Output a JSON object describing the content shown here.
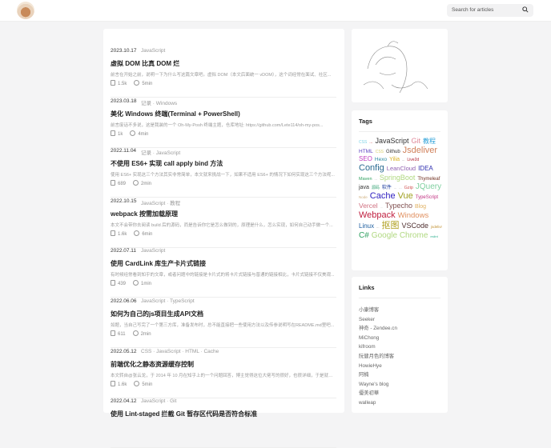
{
  "header": {
    "search_placeholder": "Search for articles"
  },
  "posts": [
    {
      "date": "2023.10.17",
      "cats": "JavaScript",
      "title": "虚拟 DOM 比真 DOM 烂",
      "excerpt": "前言在开始之前，说明一下为什么写这篇文章吧。虚拟 DOM（本文后面统一 vDOM），这个词经常在面试、社区...",
      "views": "1.5k",
      "time": "5min"
    },
    {
      "date": "2023.03.18",
      "cats": "记录 · Windows",
      "title": "美化 Windows 终端(Terminal + PowerShell)",
      "excerpt": "前言废话不多说，这是我装的一个 Oh-My-Posh 终端主题，仓库地址: https://github.com/Lete114/oh-my-pos...",
      "views": "1k",
      "time": "4min"
    },
    {
      "date": "2022.11.04",
      "cats": "记录 · JavaScript",
      "title": "不使用 ES6+ 实现 call apply bind 方法",
      "excerpt": "使用 ES6+ 实现这三个方法其实非常简单，本文就来挑战一下，如果不适用 ES6+ 的情况下如何实现这三个方法呢...",
      "views": "689",
      "time": "2min"
    },
    {
      "date": "2022.10.15",
      "cats": "JavaScript · 教程",
      "title": "webpack 按需加载原理",
      "excerpt": "本文不会带你去阅读 build 后的源码，而是告诉你它是怎么做到的，原理是什么，怎么实现，如何自己动手做一个...",
      "views": "1.6k",
      "time": "6min"
    },
    {
      "date": "2022.07.11",
      "cats": "JavaScript",
      "title": "使用 CardLink 库生产卡片式链接",
      "excerpt": "有时候经常看到知乎的文章，或者问题中的链接是卡片式的将卡片式链接与普通的链接相比，卡片式链接不仅美观...",
      "views": "439",
      "time": "1min"
    },
    {
      "date": "2022.06.06",
      "cats": "JavaScript · TypeScript",
      "title": "如何为自己的js项目生成API文档",
      "excerpt": "如题，当自己写完了一个第三方库，准备发布时，总不能直接把一些使用方法以及传参说明写在README.md里吧...",
      "views": "611",
      "time": "2min"
    },
    {
      "date": "2022.05.12",
      "cats": "CSS · JavaScript · HTML · Cache",
      "title": "前端优化之静态资源缓存控制",
      "excerpt": "本文转自@张云龙，于 2014 年 10 月在知乎上的一个问题回答，博主觉得这位大佬写的很好，也很详细，于是就把...",
      "views": "1.6k",
      "time": "5min"
    },
    {
      "date": "2022.04.12",
      "cats": "JavaScript · Git",
      "title": "使用 Lint-staged 拦截 Git 暂存区代码是否符合标准",
      "excerpt": "",
      "views": "",
      "time": ""
    }
  ],
  "tags": {
    "title": "Tags",
    "items": [
      {
        "t": "CSS",
        "s": 5,
        "c": "#7fd3e8"
      },
      {
        "t": "...",
        "s": 5,
        "c": "#c44"
      },
      {
        "t": "JavaScript",
        "s": 9,
        "c": "#333"
      },
      {
        "t": "Git",
        "s": 9,
        "c": "#e08a9a"
      },
      {
        "t": "教程",
        "s": 8,
        "c": "#2aa0d8"
      },
      {
        "t": "HTML",
        "s": 6.5,
        "c": "#5a3fc0"
      },
      {
        "t": "CSS",
        "s": 5,
        "c": "#d8d070"
      },
      {
        "t": "Github",
        "s": 6,
        "c": "#333"
      },
      {
        "t": "Jsdeliver",
        "s": 11,
        "c": "#d0805a"
      },
      {
        "t": "SEO",
        "s": 8,
        "c": "#c040c0"
      },
      {
        "t": "Hexo",
        "s": 6.5,
        "c": "#2a8aa0"
      },
      {
        "t": "Yilia",
        "s": 7,
        "c": "#d8b020"
      },
      {
        "t": "...",
        "s": 4,
        "c": "#555"
      },
      {
        "t": "Live2d",
        "s": 5,
        "c": "#b02030"
      },
      {
        "t": "Config",
        "s": 11,
        "c": "#2a6a90"
      },
      {
        "t": "LeanCloud",
        "s": 7.5,
        "c": "#9060b0"
      },
      {
        "t": "IDEA",
        "s": 8,
        "c": "#3030b0"
      },
      {
        "t": "Maven",
        "s": 5.5,
        "c": "#30a060"
      },
      {
        "t": "...",
        "s": 4,
        "c": "#888"
      },
      {
        "t": "SpringBoot",
        "s": 9,
        "c": "#b0d880"
      },
      {
        "t": "Thymeleaf",
        "s": 6,
        "c": "#703020"
      },
      {
        "t": "java",
        "s": 7,
        "c": "#333"
      },
      {
        "t": "源码",
        "s": 5,
        "c": "#30a070"
      },
      {
        "t": "软件",
        "s": 6,
        "c": "#2040a0"
      },
      {
        "t": "...",
        "s": 4,
        "c": "#888"
      },
      {
        "t": "...",
        "s": 4,
        "c": "#888"
      },
      {
        "t": "Gzip",
        "s": 5.5,
        "c": "#d05050"
      },
      {
        "t": "JQuery",
        "s": 10,
        "c": "#80d0a0"
      },
      {
        "t": "Node",
        "s": 4.5,
        "c": "#d0b080"
      },
      {
        "t": "Cache",
        "s": 11,
        "c": "#3020c0"
      },
      {
        "t": "Vue",
        "s": 11,
        "c": "#a0a020"
      },
      {
        "t": "TypeScript",
        "s": 6,
        "c": "#c03080"
      },
      {
        "t": "Vercel",
        "s": 8.5,
        "c": "#d07080"
      },
      {
        "t": "...",
        "s": 4,
        "c": "#aaa"
      },
      {
        "t": "Typecho",
        "s": 9,
        "c": "#805050"
      },
      {
        "t": "Blog",
        "s": 7,
        "c": "#e0b060"
      },
      {
        "t": "Webpack",
        "s": 11,
        "c": "#c02040"
      },
      {
        "t": "Windows",
        "s": 9.5,
        "c": "#e09060"
      },
      {
        "t": "Linux",
        "s": 8,
        "c": "#2060a0"
      },
      {
        "t": "...",
        "s": 4,
        "c": "#555"
      },
      {
        "t": "抠图",
        "s": 11,
        "c": "#b0a020"
      },
      {
        "t": "VSCode",
        "s": 9,
        "c": "#503030"
      },
      {
        "t": "jsdelivr",
        "s": 4.5,
        "c": "#c09030"
      },
      {
        "t": "C#",
        "s": 10,
        "c": "#30a060"
      },
      {
        "t": "Google Chrome",
        "s": 10,
        "c": "#b0d880"
      },
      {
        "t": "eslint",
        "s": 4,
        "c": "#30b090"
      }
    ]
  },
  "links": {
    "title": "Links",
    "items": [
      "小康博客",
      "Seeker",
      "神奇 - Zendee.cn",
      "MiChong",
      "kifroom",
      "阮健月色的博客",
      "HowieHye",
      "阿楠",
      "Wayne's blog",
      "優美初華",
      "walleap"
    ]
  }
}
